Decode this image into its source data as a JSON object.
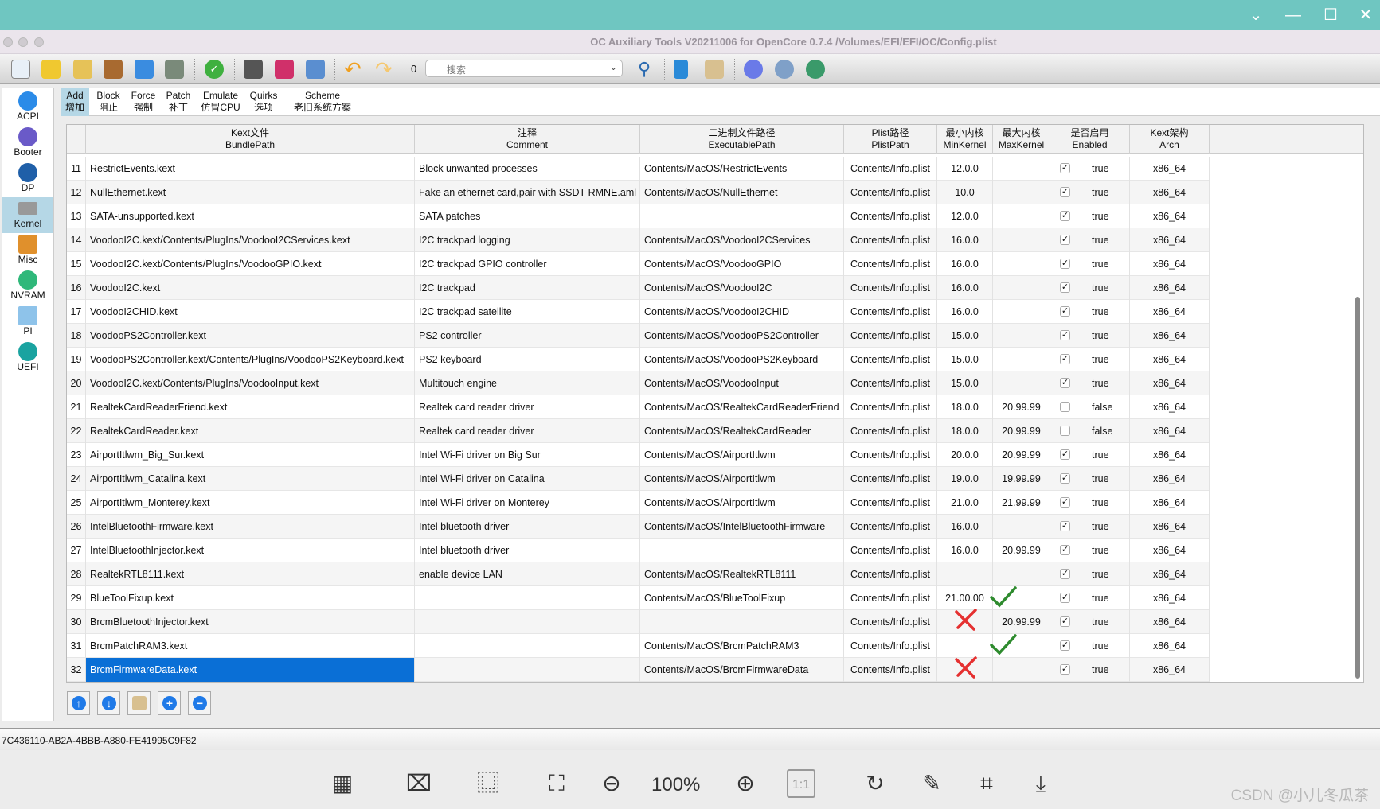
{
  "window": {
    "title": "OC Auxiliary Tools   V20211006 for OpenCore 0.7.4   /Volumes/EFI/EFI/OC/Config.plist",
    "controls": [
      "minimize",
      "restore",
      "maximize",
      "close"
    ]
  },
  "toolbar": {
    "counter": "0",
    "search_placeholder": "搜索",
    "icons": [
      "new-file-icon",
      "open-folder-icon",
      "upload-folder-icon",
      "folder-icon",
      "save-icon",
      "save-as-icon",
      "check-icon",
      "disk-icon",
      "books-icon",
      "refresh-icon",
      "undo-icon",
      "redo-icon",
      "search-icon",
      "database-icon",
      "folder-import-icon",
      "github-icon",
      "network-icon",
      "app-icon"
    ]
  },
  "sidebar": {
    "items": [
      {
        "label": "ACPI",
        "color": "#2b8be8"
      },
      {
        "label": "Booter",
        "color": "#6a5ac8"
      },
      {
        "label": "DP",
        "color": "#1f5fa8"
      },
      {
        "label": "Kernel",
        "color": "#999999",
        "active": true
      },
      {
        "label": "Misc",
        "color": "#e0902c"
      },
      {
        "label": "NVRAM",
        "color": "#2fb87a"
      },
      {
        "label": "PI",
        "color": "#8ec3ea"
      },
      {
        "label": "UEFI",
        "color": "#1aa3a0"
      }
    ]
  },
  "tabs": [
    {
      "en": "Add",
      "zh": "增加",
      "active": true
    },
    {
      "en": "Block",
      "zh": "阻止"
    },
    {
      "en": "Force",
      "zh": "强制"
    },
    {
      "en": "Patch",
      "zh": "补丁"
    },
    {
      "en": "Emulate",
      "zh": "仿冒CPU"
    },
    {
      "en": "Quirks",
      "zh": "选项"
    },
    {
      "en": "Scheme",
      "zh": "老旧系统方案"
    }
  ],
  "table": {
    "columns": [
      {
        "zh": "",
        "en": ""
      },
      {
        "zh": "Kext文件",
        "en": "BundlePath"
      },
      {
        "zh": "注释",
        "en": "Comment"
      },
      {
        "zh": "二进制文件路径",
        "en": "ExecutablePath"
      },
      {
        "zh": "Plist路径",
        "en": "PlistPath"
      },
      {
        "zh": "最小内核",
        "en": "MinKernel"
      },
      {
        "zh": "最大内核",
        "en": "MaxKernel"
      },
      {
        "zh": "是否启用",
        "en": "Enabled"
      },
      {
        "zh": "Kext架构",
        "en": "Arch"
      }
    ],
    "rows": [
      {
        "n": "11",
        "bundle": "RestrictEvents.kext",
        "comment": "Block unwanted processes",
        "exec": "Contents/MacOS/RestrictEvents",
        "plist": "Contents/Info.plist",
        "min": "12.0.0",
        "max": "",
        "enabled": true,
        "enabled_text": "true",
        "arch": "x86_64"
      },
      {
        "n": "12",
        "bundle": "NullEthernet.kext",
        "comment": "Fake an ethernet card,pair with SSDT-RMNE.aml",
        "exec": "Contents/MacOS/NullEthernet",
        "plist": "Contents/Info.plist",
        "min": "10.0",
        "max": "",
        "enabled": true,
        "enabled_text": "true",
        "arch": "x86_64"
      },
      {
        "n": "13",
        "bundle": "SATA-unsupported.kext",
        "comment": "SATA patches",
        "exec": "",
        "plist": "Contents/Info.plist",
        "min": "12.0.0",
        "max": "",
        "enabled": true,
        "enabled_text": "true",
        "arch": "x86_64"
      },
      {
        "n": "14",
        "bundle": "VoodooI2C.kext/Contents/PlugIns/VoodooI2CServices.kext",
        "comment": "I2C trackpad logging",
        "exec": "Contents/MacOS/VoodooI2CServices",
        "plist": "Contents/Info.plist",
        "min": "16.0.0",
        "max": "",
        "enabled": true,
        "enabled_text": "true",
        "arch": "x86_64"
      },
      {
        "n": "15",
        "bundle": "VoodooI2C.kext/Contents/PlugIns/VoodooGPIO.kext",
        "comment": "I2C trackpad GPIO controller",
        "exec": "Contents/MacOS/VoodooGPIO",
        "plist": "Contents/Info.plist",
        "min": "16.0.0",
        "max": "",
        "enabled": true,
        "enabled_text": "true",
        "arch": "x86_64"
      },
      {
        "n": "16",
        "bundle": "VoodooI2C.kext",
        "comment": "I2C trackpad",
        "exec": "Contents/MacOS/VoodooI2C",
        "plist": "Contents/Info.plist",
        "min": "16.0.0",
        "max": "",
        "enabled": true,
        "enabled_text": "true",
        "arch": "x86_64"
      },
      {
        "n": "17",
        "bundle": "VoodooI2CHID.kext",
        "comment": "I2C trackpad satellite",
        "exec": "Contents/MacOS/VoodooI2CHID",
        "plist": "Contents/Info.plist",
        "min": "16.0.0",
        "max": "",
        "enabled": true,
        "enabled_text": "true",
        "arch": "x86_64"
      },
      {
        "n": "18",
        "bundle": "VoodooPS2Controller.kext",
        "comment": "PS2 controller",
        "exec": "Contents/MacOS/VoodooPS2Controller",
        "plist": "Contents/Info.plist",
        "min": "15.0.0",
        "max": "",
        "enabled": true,
        "enabled_text": "true",
        "arch": "x86_64"
      },
      {
        "n": "19",
        "bundle": "VoodooPS2Controller.kext/Contents/PlugIns/VoodooPS2Keyboard.kext",
        "comment": "PS2 keyboard",
        "exec": "Contents/MacOS/VoodooPS2Keyboard",
        "plist": "Contents/Info.plist",
        "min": "15.0.0",
        "max": "",
        "enabled": true,
        "enabled_text": "true",
        "arch": "x86_64"
      },
      {
        "n": "20",
        "bundle": "VoodooI2C.kext/Contents/PlugIns/VoodooInput.kext",
        "comment": "Multitouch engine",
        "exec": "Contents/MacOS/VoodooInput",
        "plist": "Contents/Info.plist",
        "min": "15.0.0",
        "max": "",
        "enabled": true,
        "enabled_text": "true",
        "arch": "x86_64"
      },
      {
        "n": "21",
        "bundle": "RealtekCardReaderFriend.kext",
        "comment": "Realtek card reader driver",
        "exec": "Contents/MacOS/RealtekCardReaderFriend",
        "plist": "Contents/Info.plist",
        "min": "18.0.0",
        "max": "20.99.99",
        "enabled": false,
        "enabled_text": "false",
        "arch": "x86_64"
      },
      {
        "n": "22",
        "bundle": "RealtekCardReader.kext",
        "comment": "Realtek card reader driver",
        "exec": "Contents/MacOS/RealtekCardReader",
        "plist": "Contents/Info.plist",
        "min": "18.0.0",
        "max": "20.99.99",
        "enabled": false,
        "enabled_text": "false",
        "arch": "x86_64"
      },
      {
        "n": "23",
        "bundle": "AirportItlwm_Big_Sur.kext",
        "comment": "Intel Wi-Fi driver on Big Sur",
        "exec": "Contents/MacOS/AirportItlwm",
        "plist": "Contents/Info.plist",
        "min": "20.0.0",
        "max": "20.99.99",
        "enabled": true,
        "enabled_text": "true",
        "arch": "x86_64"
      },
      {
        "n": "24",
        "bundle": "AirportItlwm_Catalina.kext",
        "comment": "Intel Wi-Fi driver on Catalina",
        "exec": "Contents/MacOS/AirportItlwm",
        "plist": "Contents/Info.plist",
        "min": "19.0.0",
        "max": "19.99.99",
        "enabled": true,
        "enabled_text": "true",
        "arch": "x86_64"
      },
      {
        "n": "25",
        "bundle": "AirportItlwm_Monterey.kext",
        "comment": "Intel Wi-Fi driver on Monterey",
        "exec": "Contents/MacOS/AirportItlwm",
        "plist": "Contents/Info.plist",
        "min": "21.0.0",
        "max": "21.99.99",
        "enabled": true,
        "enabled_text": "true",
        "arch": "x86_64"
      },
      {
        "n": "26",
        "bundle": "IntelBluetoothFirmware.kext",
        "comment": "Intel bluetooth driver",
        "exec": "Contents/MacOS/IntelBluetoothFirmware",
        "plist": "Contents/Info.plist",
        "min": "16.0.0",
        "max": "",
        "enabled": true,
        "enabled_text": "true",
        "arch": "x86_64"
      },
      {
        "n": "27",
        "bundle": "IntelBluetoothInjector.kext",
        "comment": "Intel bluetooth driver",
        "exec": "",
        "plist": "Contents/Info.plist",
        "min": "16.0.0",
        "max": "20.99.99",
        "enabled": true,
        "enabled_text": "true",
        "arch": "x86_64"
      },
      {
        "n": "28",
        "bundle": "RealtekRTL8111.kext",
        "comment": "enable device LAN",
        "exec": "Contents/MacOS/RealtekRTL8111",
        "plist": "Contents/Info.plist",
        "min": "",
        "max": "",
        "enabled": true,
        "enabled_text": "true",
        "arch": "x86_64"
      },
      {
        "n": "29",
        "bundle": "BlueToolFixup.kext",
        "comment": "",
        "exec": "Contents/MacOS/BlueToolFixup",
        "plist": "Contents/Info.plist",
        "min": "21.00.00",
        "max": "",
        "enabled": true,
        "enabled_text": "true",
        "arch": "x86_64",
        "annot_max": "check"
      },
      {
        "n": "30",
        "bundle": "BrcmBluetoothInjector.kext",
        "comment": "",
        "exec": "",
        "plist": "Contents/Info.plist",
        "min": "",
        "max": "20.99.99",
        "enabled": true,
        "enabled_text": "true",
        "arch": "x86_64",
        "annot_min": "cross"
      },
      {
        "n": "31",
        "bundle": "BrcmPatchRAM3.kext",
        "comment": "",
        "exec": "Contents/MacOS/BrcmPatchRAM3",
        "plist": "Contents/Info.plist",
        "min": "",
        "max": "",
        "enabled": true,
        "enabled_text": "true",
        "arch": "x86_64",
        "annot_max": "check"
      },
      {
        "n": "32",
        "bundle": "BrcmFirmwareData.kext",
        "comment": "",
        "exec": "Contents/MacOS/BrcmFirmwareData",
        "plist": "Contents/Info.plist",
        "min": "",
        "max": "",
        "enabled": true,
        "enabled_text": "true",
        "arch": "x86_64",
        "annot_min": "cross",
        "selected": true
      }
    ]
  },
  "bottom_buttons": [
    "move-up",
    "move-down",
    "import",
    "add",
    "remove"
  ],
  "status": {
    "text": "7C436110-AB2A-4BBB-A880-FE41995C9F82"
  },
  "viewer": {
    "zoom": "100%",
    "one_to_one": "1:1",
    "watermark": "CSDN @小儿冬瓜茶"
  },
  "colors": {
    "selection": "#0a6fd6",
    "accent_teal": "#6fc6c1",
    "check_mark": "#2e8b2e",
    "cross_mark": "#e53030"
  }
}
